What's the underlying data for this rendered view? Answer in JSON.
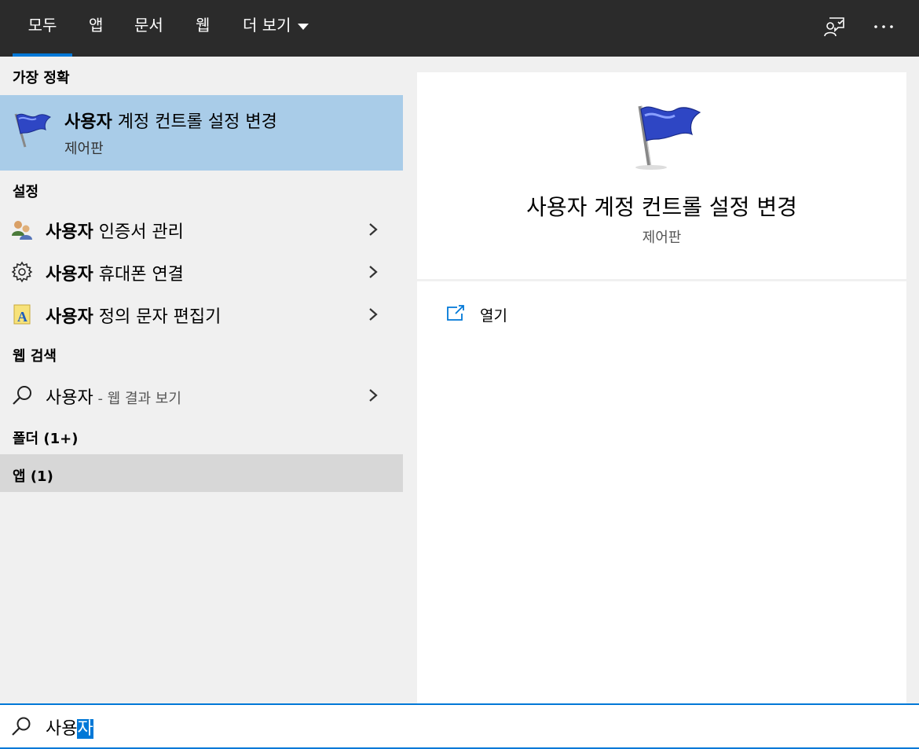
{
  "tabs": [
    {
      "label": "모두",
      "active": true
    },
    {
      "label": "앱"
    },
    {
      "label": "문서"
    },
    {
      "label": "웹"
    },
    {
      "label": "더 보기"
    }
  ],
  "top_icons": [
    "feedback-icon",
    "more-icon"
  ],
  "left": {
    "best_match_header": "가장 정확",
    "best_match": {
      "title_bold": "사용자",
      "title_rest": " 계정 컨트롤 설정 변경",
      "subtitle": "제어판",
      "icon": "uac-flag-icon"
    },
    "settings_header": "설정",
    "settings": [
      {
        "bold": "사용자",
        "rest": " 인증서 관리",
        "icon": "users-icon"
      },
      {
        "bold": "사용자",
        "rest": " 휴대폰 연결",
        "icon": "gear-icon"
      },
      {
        "bold": "사용자",
        "rest": " 정의 문자 편집기",
        "icon": "font-editor-icon"
      }
    ],
    "web_header": "웹 검색",
    "web": {
      "query": "사용자",
      "suffix": " - 웹 결과 보기"
    },
    "folders_header": "폴더 (1+)",
    "apps_header": "앱 (1)"
  },
  "right": {
    "title": "사용자 계정 컨트롤 설정 변경",
    "subtitle": "제어판",
    "actions": [
      {
        "label": "열기",
        "icon": "open-icon"
      }
    ]
  },
  "search": {
    "typed": "사용",
    "selected": "자"
  },
  "colors": {
    "accent": "#0078d7",
    "selection_bg": "#a9cce8",
    "topbar": "#2b2b2b"
  }
}
